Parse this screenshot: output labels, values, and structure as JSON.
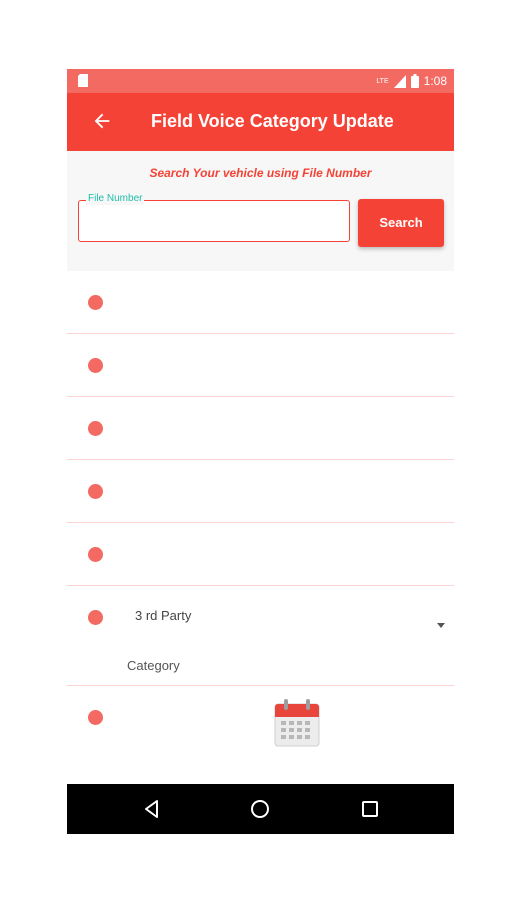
{
  "status_bar": {
    "time": "1:08",
    "network": "LTE",
    "icons": [
      "sim-card-icon",
      "signal-icon",
      "battery-icon"
    ]
  },
  "app_bar": {
    "title": "Field Voice Category Update",
    "back_icon": "arrow-left-icon"
  },
  "search": {
    "hint": "Search Your vehicle using File Number",
    "field_label": "File Number",
    "field_value": "",
    "button_label": "Search"
  },
  "rows": [
    {
      "text": ""
    },
    {
      "text": ""
    },
    {
      "text": ""
    },
    {
      "text": ""
    },
    {
      "text": ""
    }
  ],
  "category_row": {
    "selected": "3 rd Party",
    "label": "Category"
  },
  "date_row": {
    "icon": "calendar-icon"
  },
  "nav_bar": {
    "icons": [
      "back-triangle-icon",
      "home-circle-icon",
      "recents-square-icon"
    ]
  },
  "colors": {
    "primary": "#f44336",
    "status_bar": "#f26a62",
    "accent": "#1fbfa8",
    "dot": "#f26a62",
    "divider": "#fbd4d2"
  }
}
